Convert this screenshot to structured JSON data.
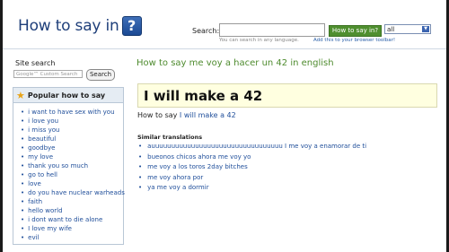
{
  "header": {
    "logo_text": "How to say in",
    "logo_mark": "?",
    "search_label": "Search:",
    "search_value": "",
    "search_button": "How to say in?",
    "language_select": "all",
    "search_hint": "You can search in any language.",
    "toolbar_link": "Add this to your browser toolbar!"
  },
  "sidebar": {
    "site_search_title": "Site search",
    "cse_placeholder": "Google™ Custom Search",
    "cse_button": "Search",
    "popular_title": "Popular how to say",
    "popular_items": [
      "i want to have sex with you",
      "i love you",
      "i miss you",
      "beautiful",
      "goodbye",
      "my love",
      "thank you so much",
      "go to hell",
      "love",
      "do you have nuclear warheads",
      "faith",
      "hello world",
      "i dont want to die alone",
      "I love my wife",
      "evil"
    ]
  },
  "main": {
    "title": "How to say me voy a hacer un 42 in english",
    "answer": "I will make a 42",
    "howto_prefix": "How to say",
    "howto_link": "I will make a 42",
    "similar_title": "Similar translations",
    "similar_items": [
      "auuuuuuuuuuuuuuuuuuuuuuuuuuuuuuuuu I me voy a enamorar de ti",
      "bueonos chicos ahora me voy yo",
      "me voy a los toros 2day bitches",
      "me voy ahora por",
      "ya me voy a dormir"
    ]
  },
  "colors": {
    "title_green": "#4e8b2e",
    "link_blue": "#1f4e9a",
    "answer_bg": "#ffffe0",
    "button_green": "#4f8f2f"
  },
  "icons": [
    "question-mark-logo-icon",
    "star-icon",
    "select-arrow-icon"
  ]
}
